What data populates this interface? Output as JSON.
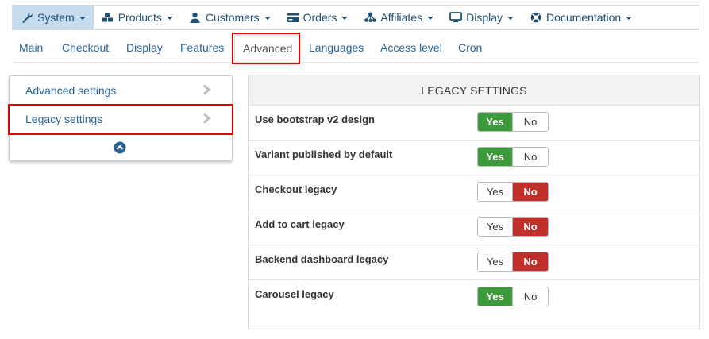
{
  "topmenu": {
    "items": [
      {
        "label": "System",
        "icon": "wrench-icon"
      },
      {
        "label": "Products",
        "icon": "cubes-icon"
      },
      {
        "label": "Customers",
        "icon": "user-icon"
      },
      {
        "label": "Orders",
        "icon": "credit-card-icon"
      },
      {
        "label": "Affiliates",
        "icon": "sitemap-icon"
      },
      {
        "label": "Display",
        "icon": "monitor-icon"
      },
      {
        "label": "Documentation",
        "icon": "lifebuoy-icon"
      }
    ],
    "active": "System"
  },
  "tabs": {
    "items": [
      "Main",
      "Checkout",
      "Display",
      "Features",
      "Advanced",
      "Languages",
      "Access level",
      "Cron"
    ],
    "active": "Advanced"
  },
  "sidebar": {
    "items": [
      {
        "label": "Advanced settings"
      },
      {
        "label": "Legacy settings"
      }
    ],
    "highlighted": "Legacy settings"
  },
  "panel": {
    "title": "LEGACY SETTINGS",
    "yes_label": "Yes",
    "no_label": "No",
    "rows": [
      {
        "label": "Use bootstrap v2 design",
        "value": "Yes"
      },
      {
        "label": "Variant published by default",
        "value": "Yes"
      },
      {
        "label": "Checkout legacy",
        "value": "No"
      },
      {
        "label": "Add to cart legacy",
        "value": "No"
      },
      {
        "label": "Backend dashboard legacy",
        "value": "No"
      },
      {
        "label": "Carousel legacy",
        "value": "Yes"
      }
    ]
  },
  "colors": {
    "yes_active": "#3c9a3c",
    "no_active": "#c0302a",
    "menu_active_bg": "#c4dcee",
    "highlight": "#e00000",
    "link": "#2a6496"
  }
}
